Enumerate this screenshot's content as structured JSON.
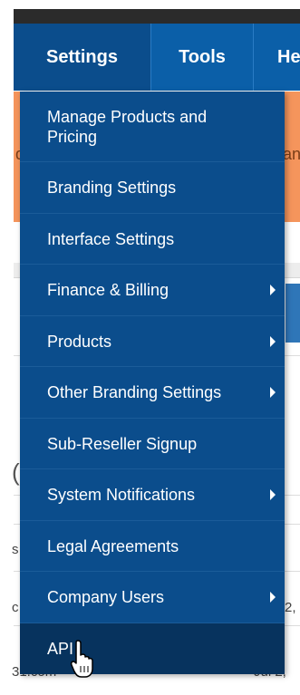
{
  "nav": {
    "tabs": [
      {
        "label": "Settings",
        "active": true
      },
      {
        "label": "Tools"
      },
      {
        "label": "He"
      }
    ]
  },
  "background": {
    "orange_left": "d",
    "orange_right": "an",
    "row_frag_1": "s",
    "row_frag_2": "c",
    "row_frag_3": "31.com",
    "row_date_1": "2,",
    "row_date_2": "Jul 2,",
    "big_frag": "("
  },
  "menu": {
    "items": [
      {
        "label": "Manage Products and Pricing",
        "submenu": false
      },
      {
        "label": "Branding Settings",
        "submenu": false
      },
      {
        "label": "Interface Settings",
        "submenu": false
      },
      {
        "label": "Finance & Billing",
        "submenu": true
      },
      {
        "label": "Products",
        "submenu": true
      },
      {
        "label": "Other Branding Settings",
        "submenu": true
      },
      {
        "label": "Sub-Reseller Signup",
        "submenu": false
      },
      {
        "label": "System Notifications",
        "submenu": true
      },
      {
        "label": "Legal Agreements",
        "submenu": false
      },
      {
        "label": "Company Users",
        "submenu": true
      },
      {
        "label": "API",
        "submenu": false,
        "hovered": true
      }
    ]
  },
  "colors": {
    "nav_blue": "#0b5fa8",
    "menu_blue": "#0b4d8c",
    "menu_hover": "#07335e",
    "banner_orange": "#f5955c"
  },
  "icons": {
    "cursor": "hand-pointer-icon",
    "submenu": "chevron-right-icon"
  }
}
